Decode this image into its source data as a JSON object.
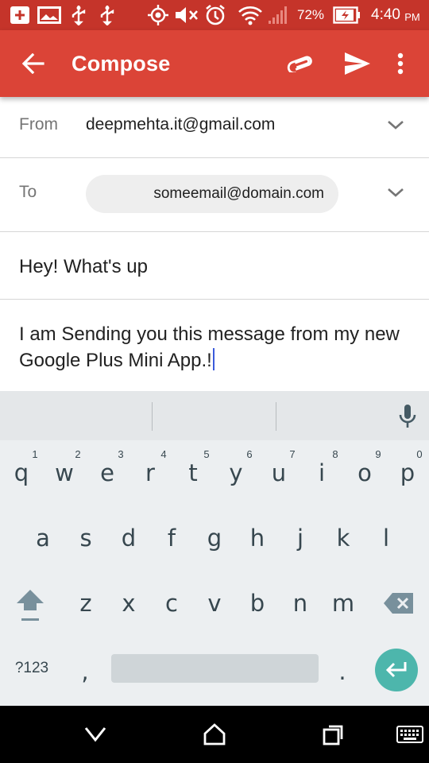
{
  "status_bar": {
    "battery_percent": "72%",
    "time": "4:40",
    "ampm": "PM",
    "icons": [
      "add-box-icon",
      "image-icon",
      "usb-icon",
      "usb-icon",
      "gps-icon",
      "mute-icon",
      "alarm-icon",
      "wifi-icon",
      "signal-icon",
      "battery-charging-icon"
    ]
  },
  "app_bar": {
    "title": "Compose",
    "icons": [
      "back-arrow-icon",
      "attach-icon",
      "send-icon",
      "more-vert-icon"
    ],
    "color": "#db4437"
  },
  "compose": {
    "from_label": "From",
    "from_value": "deepmehta.it@gmail.com",
    "to_label": "To",
    "to_chip": "someemail@domain.com",
    "subject": "Hey! What's up",
    "body": "I am Sending you this message from my new Google Plus Mini App.!"
  },
  "keyboard": {
    "row1": [
      "q",
      "w",
      "e",
      "r",
      "t",
      "y",
      "u",
      "i",
      "o",
      "p"
    ],
    "row1_hints": [
      "1",
      "2",
      "3",
      "4",
      "5",
      "6",
      "7",
      "8",
      "9",
      "0"
    ],
    "row2": [
      "a",
      "s",
      "d",
      "f",
      "g",
      "h",
      "j",
      "k",
      "l"
    ],
    "row3": [
      "z",
      "x",
      "c",
      "v",
      "b",
      "n",
      "m"
    ],
    "symbols_key": "?123",
    "comma_key": ",",
    "period_key": ".",
    "enter_color": "#4db6ac"
  },
  "nav_bar": {
    "icons": [
      "back-icon",
      "home-icon",
      "recents-icon",
      "keyboard-icon"
    ]
  }
}
